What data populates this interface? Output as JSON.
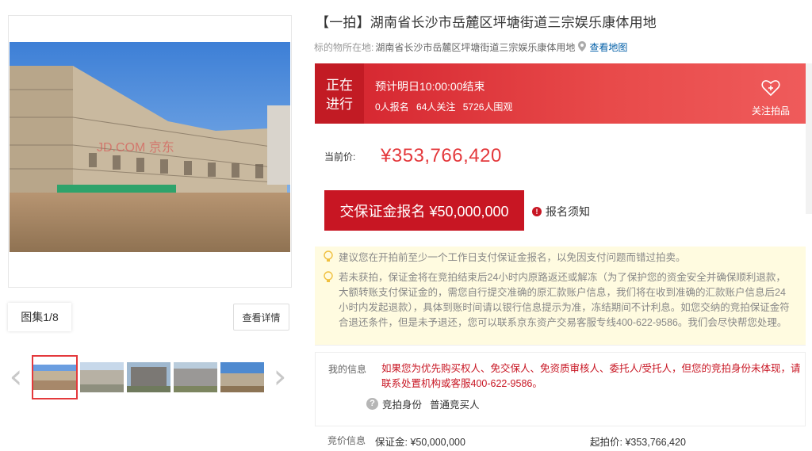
{
  "gallery": {
    "counter": "图集1/8",
    "detail_button": "查看详情",
    "watermark": "JD.COM 京东",
    "prev_arrow": "‹",
    "next_arrow": "›"
  },
  "listing": {
    "title": "【一拍】湖南省长沙市岳麓区坪塘街道三宗娱乐康体用地",
    "location_label": "标的物所在地:",
    "location": "湖南省长沙市岳麓区坪塘街道三宗娱乐康体用地",
    "map_link": "查看地图"
  },
  "status": {
    "badge_line1": "正在",
    "badge_line2": "进行",
    "countdown": "预计明日10:00:00结束",
    "signups": "0人报名",
    "followers": "64人关注",
    "viewers": "5726人围观",
    "follow_label": "关注拍品"
  },
  "price": {
    "label": "当前价:",
    "value": "¥353,766,420"
  },
  "actions": {
    "deposit_button": "交保证金报名 ¥50,000,000",
    "notice_link": "报名须知",
    "notice_icon": "!"
  },
  "tips": {
    "tip1": "建议您在开拍前至少一个工作日支付保证金报名，以免因支付问题而错过拍卖。",
    "tip2": "若未获拍，保证金将在竞拍结束后24小时内原路返还或解冻（为了保护您的资金安全并确保顺利退款，大额转账支付保证金的，需您自行提交准确的原汇款账户信息，我们将在收到准确的汇款账户信息后24小时内发起退款），具体到账时间请以银行信息提示为准，冻结期间不计利息。如您交纳的竞拍保证金符合退还条件，但是未予退还，您可以联系京东资产交易客服专线400-622-9586。我们会尽快帮您处理。"
  },
  "my_info": {
    "label": "我的信息",
    "text": "如果您为优先购买权人、免交保人、免资质审核人、委托人/受托人，但您的竞拍身份未体现，请联系处置机构或客服400-622-9586。",
    "identity_icon": "?",
    "identity_label": "竞拍身份",
    "identity_value": "普通竞买人"
  },
  "bid_info": {
    "label": "竞价信息",
    "deposit": "保证金: ¥50,000,000",
    "start_price": "起拍价: ¥353,766,420"
  },
  "colors": {
    "accent": "#c81623",
    "link": "#005ea7",
    "tip_bg": "#fffbe0"
  }
}
